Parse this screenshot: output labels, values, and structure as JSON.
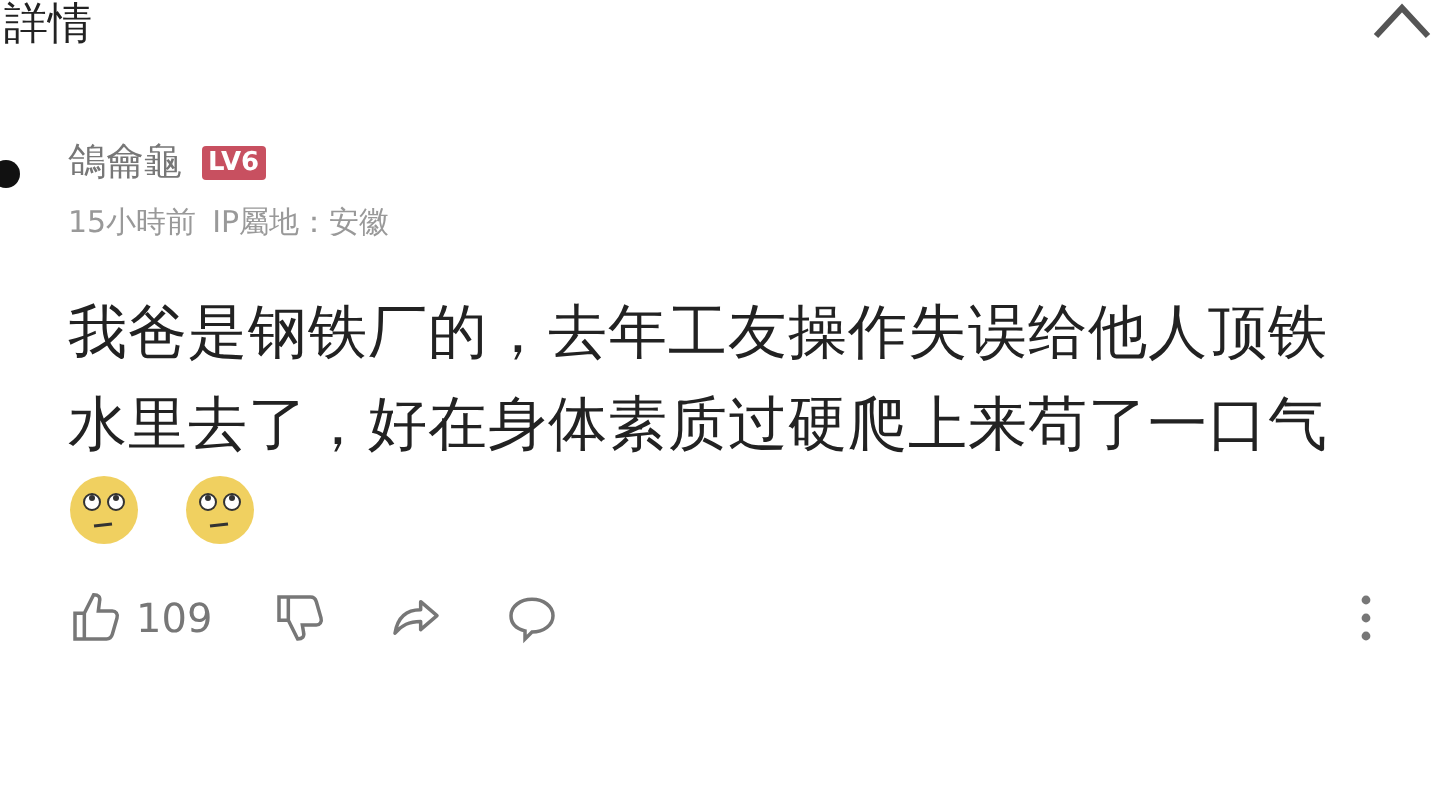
{
  "header": {
    "title": "詳情"
  },
  "comment": {
    "author": "鴿龠龜",
    "level_badge": "LV6",
    "time": "15小時前",
    "ip_location": "IP屬地：安徽",
    "text": "我爸是钢铁厂的，去年工友操作失误给他人顶铁水里去了，好在身体素质过硬爬上来苟了一口气",
    "likes": "109"
  }
}
